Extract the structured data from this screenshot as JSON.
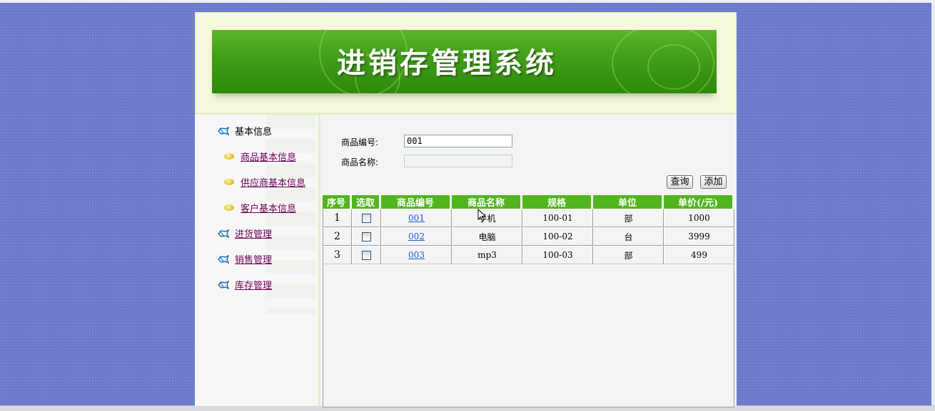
{
  "header": {
    "title": "进销存管理系统"
  },
  "sidebar": {
    "items": [
      {
        "label": "基本信息",
        "level": 1,
        "link": false,
        "icon": "fish-icon"
      },
      {
        "label": "商品基本信息",
        "level": 2,
        "link": true,
        "icon": "leaf-icon"
      },
      {
        "label": "供应商基本信息",
        "level": 2,
        "link": true,
        "icon": "leaf-icon"
      },
      {
        "label": "客户基本信息",
        "level": 2,
        "link": true,
        "icon": "leaf-icon"
      },
      {
        "label": "进货管理",
        "level": 1,
        "link": true,
        "icon": "fish-icon"
      },
      {
        "label": "销售管理",
        "level": 1,
        "link": true,
        "icon": "fish-icon"
      },
      {
        "label": "库存管理",
        "level": 1,
        "link": true,
        "icon": "fish-icon"
      }
    ]
  },
  "search": {
    "code_label": "商品编号:",
    "code_value": "001",
    "name_label": "商品名称:",
    "name_value": ""
  },
  "buttons": {
    "query": "查询",
    "add": "添加"
  },
  "table": {
    "columns": [
      "序号",
      "选取",
      "商品编号",
      "商品名称",
      "规格",
      "单位",
      "单价(/元)"
    ],
    "rows": [
      {
        "index": "1",
        "code": "001",
        "name": "手机",
        "spec": "100-01",
        "unit": "部",
        "price": "1000"
      },
      {
        "index": "2",
        "code": "002",
        "name": "电脑",
        "spec": "100-02",
        "unit": "台",
        "price": "3999"
      },
      {
        "index": "3",
        "code": "003",
        "name": "mp3",
        "spec": "100-03",
        "unit": "部",
        "price": "499"
      }
    ]
  },
  "colors": {
    "accent": "#52b41f",
    "link": "#6b0057",
    "code_link": "#1a5bd6",
    "background": "#6a79c9"
  }
}
